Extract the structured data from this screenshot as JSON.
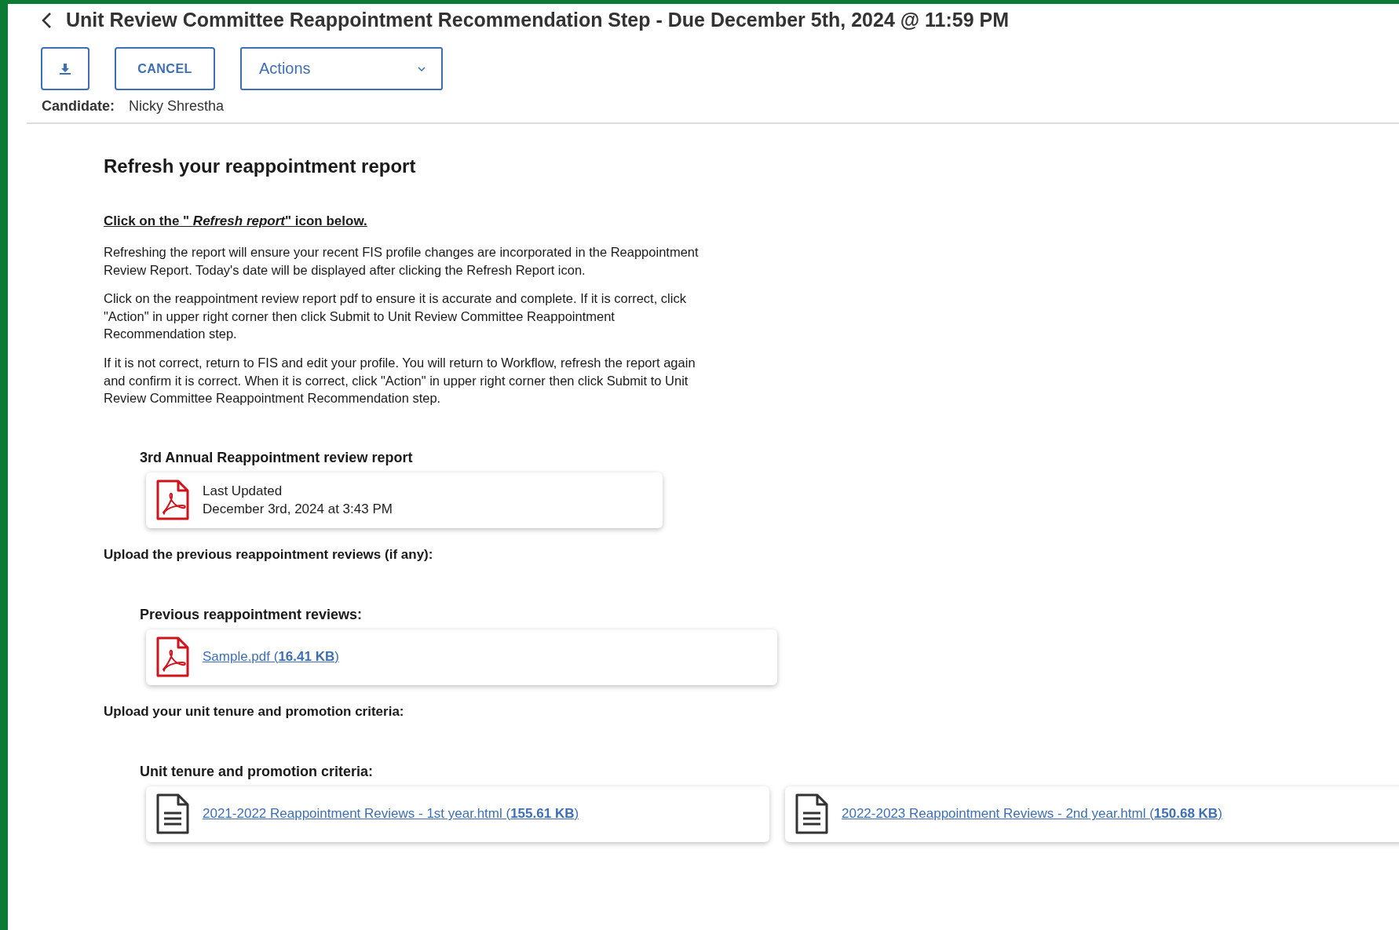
{
  "header": {
    "title": "Unit Review Committee Reappointment Recommendation Step - Due December 5th, 2024 @ 11:59 PM"
  },
  "toolbar": {
    "cancel": "CANCEL",
    "actions": "Actions"
  },
  "candidate": {
    "label": "Candidate:",
    "value": "Nicky Shrestha"
  },
  "content": {
    "heading": "Refresh your reappointment report",
    "instruction": "Click on the \" *Refresh report*\" icon below.",
    "paragraphs": [
      "Refreshing the report will ensure your recent FIS profile changes are incorporated in the Reappointment Review Report.  Today's date will be displayed after clicking the Refresh Report icon.",
      "Click on the reappointment review report pdf to ensure it is accurate and complete.  If it is correct, click \"Action\" in upper right corner then click Submit to Unit Review Committee Reappointment Recommendation step.",
      "If it is not correct, return to FIS and edit your profile. You will return to Workflow, refresh the report again and confirm it is correct.  When it is correct, click \"Action\" in upper right corner then click Submit to Unit Review Committee Reappointment Recommendation step."
    ],
    "report": {
      "label": "3rd Annual Reappointment review report",
      "kind": "pdf",
      "status": "Last Updated",
      "date": "December 3rd, 2024 at 3:43 PM"
    },
    "uploads": [
      {
        "prompt": "Upload the previous reappointment reviews (if any):",
        "label": "Previous reappointment reviews:",
        "files": [
          {
            "kind": "pdf",
            "name": "Sample.pdf (**16.41 KB**)"
          }
        ]
      },
      {
        "prompt": "Upload your unit tenure and promotion criteria:",
        "label": "Unit tenure and promotion criteria:",
        "files": [
          {
            "kind": "document",
            "name": "2021-2022 Reappointment Reviews - 1st year.html (**155.61 KB**)"
          },
          {
            "kind": "document",
            "name": "2022-2023 Reappointment Reviews - 2nd year.html (**150.68 KB**)"
          }
        ]
      }
    ]
  }
}
